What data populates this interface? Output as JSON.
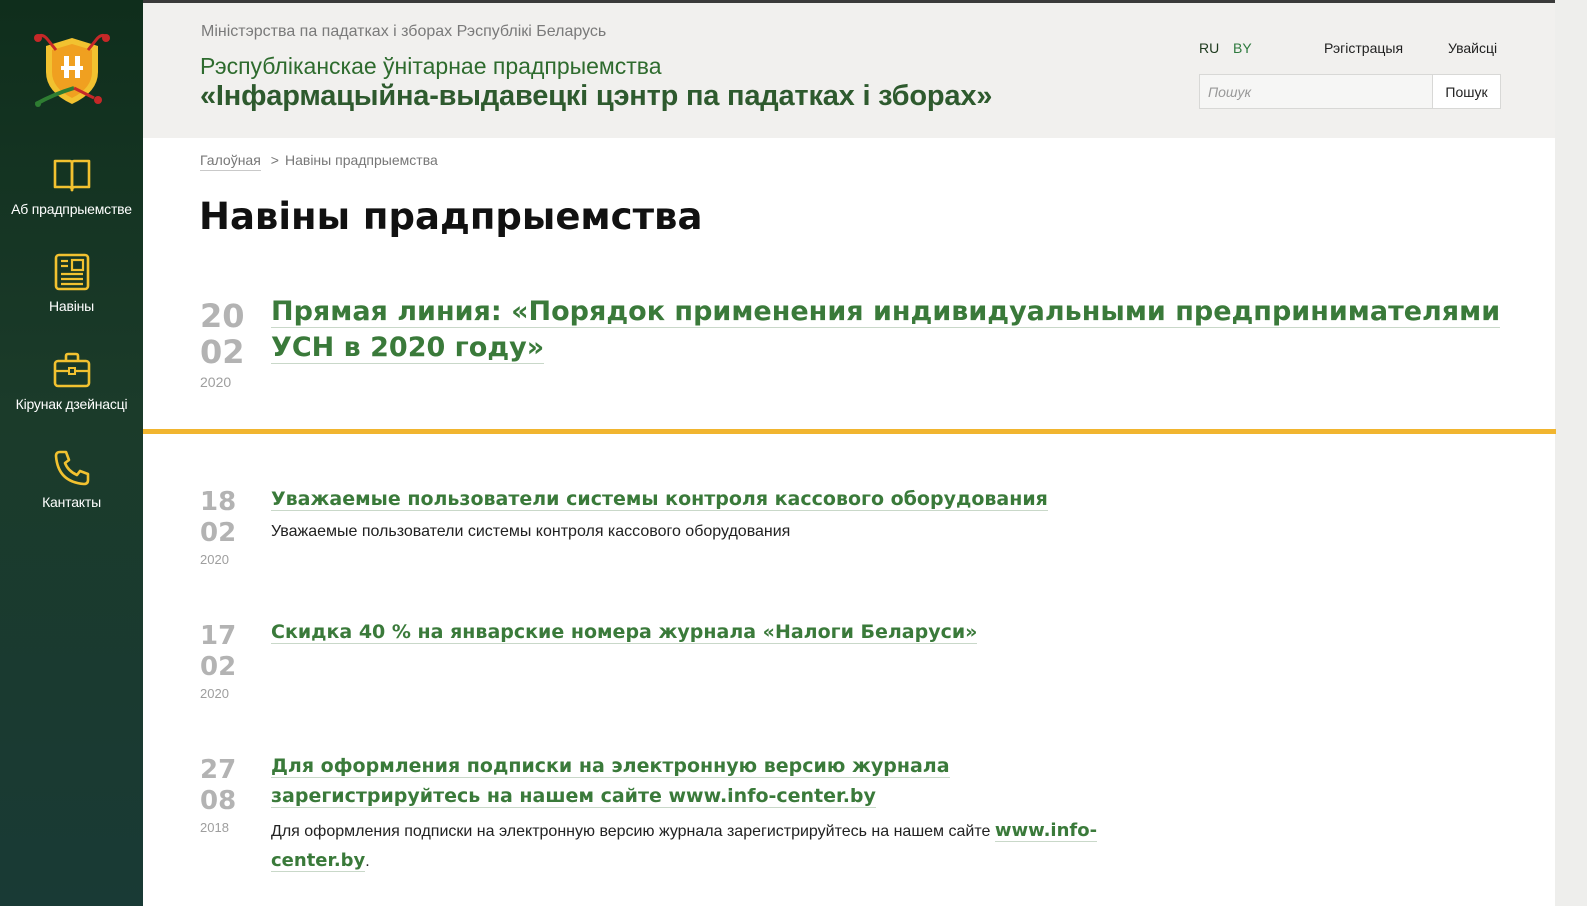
{
  "sidebar": {
    "items": [
      {
        "label": "Аб прадпрыемстве",
        "icon": "book-icon"
      },
      {
        "label": "Навіны",
        "icon": "newspaper-icon"
      },
      {
        "label": "Кірунак дзейнасці",
        "icon": "briefcase-icon"
      },
      {
        "label": "Кантакты",
        "icon": "phone-icon"
      }
    ]
  },
  "header": {
    "ministry": "Міністэрства па падатках і зборах Рэспублікі Беларусь",
    "org_line1": "Рэспубліканскае ўнітарнае прадпрыемства",
    "org_line2": "«Інфармацыйна-выдавецкі цэнтр па падатках і зборах»",
    "lang_ru": "RU",
    "lang_by": "BY",
    "register": "Рэгістрацыя",
    "login": "Увайсці",
    "search_placeholder": "Пошук",
    "search_button": "Пошук"
  },
  "breadcrumb": {
    "home": "Галоўная",
    "separator": ">",
    "current": "Навіны прадпрыемства"
  },
  "page_title": "Навіны прадпрыемства",
  "featured": {
    "day": "20",
    "month": "02",
    "year": "2020",
    "title": "Прямая линия: «Порядок применения индивидуальными предпринимателями УСН в 2020 году»"
  },
  "news": [
    {
      "day": "18",
      "month": "02",
      "year": "2020",
      "title": "Уважаемые пользователи системы контроля кассового оборудования",
      "desc": "Уважаемые пользователи системы контроля кассового оборудования"
    },
    {
      "day": "17",
      "month": "02",
      "year": "2020",
      "title": "Скидка 40 % на январские номера журнала «Налоги Беларуси»",
      "desc": ""
    },
    {
      "day": "27",
      "month": "08",
      "year": "2018",
      "title": "Для оформления подписки на электронную версию журнала зарегистрируйтесь на нашем сайте www.info-center.by",
      "desc": "Для оформления подписки на электронную версию журнала зарегистрируйтесь на нашем сайте ",
      "link": "www.info-center.by",
      "desc_end": "."
    }
  ],
  "colors": {
    "accent_green": "#3a7a3a",
    "divider_yellow": "#f1b52f",
    "sidebar_dark": "#1b3b2a",
    "icon_yellow": "#f2c230"
  }
}
